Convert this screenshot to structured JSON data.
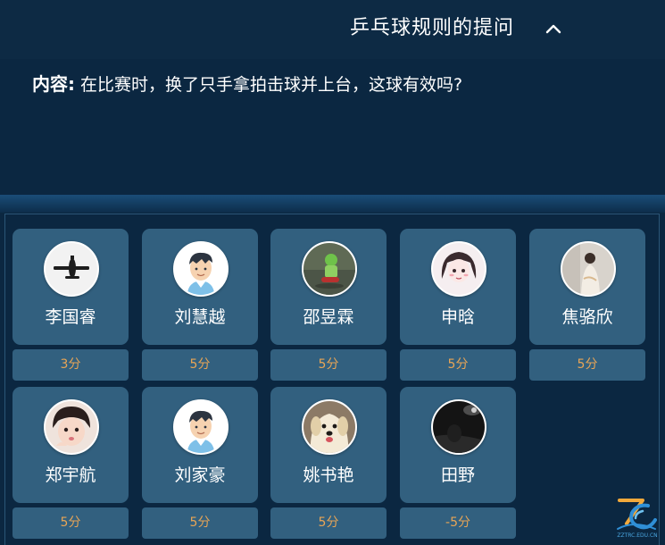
{
  "header": {
    "title": "乒乓球规则的提问"
  },
  "content": {
    "label": "内容:",
    "text": "在比赛时，换了只手拿拍击球并上台，这球有效吗?"
  },
  "students": [
    {
      "name": "李国睿",
      "score": "3分",
      "avatar": "airplane-avatar-icon"
    },
    {
      "name": "刘慧越",
      "score": "5分",
      "avatar": "default-boy-avatar-icon"
    },
    {
      "name": "邵昱霖",
      "score": "5分",
      "avatar": "toy-figure-avatar-icon"
    },
    {
      "name": "申晗",
      "score": "5分",
      "avatar": "anime-girl-avatar-icon"
    },
    {
      "name": "焦骆欣",
      "score": "5分",
      "avatar": "girl-photo-avatar-icon"
    },
    {
      "name": "郑宇航",
      "score": "5分",
      "avatar": "child-photo-avatar-icon"
    },
    {
      "name": "刘家豪",
      "score": "5分",
      "avatar": "default-boy-avatar-icon"
    },
    {
      "name": "姚书艳",
      "score": "5分",
      "avatar": "puppy-avatar-icon"
    },
    {
      "name": "田野",
      "score": "-5分",
      "avatar": "night-scene-avatar-icon"
    }
  ],
  "logo": {
    "text": "ZZTRC.EDU.CN"
  },
  "colors": {
    "background": "#0b2741",
    "card": "#32607f",
    "score_text": "#e8a556"
  }
}
